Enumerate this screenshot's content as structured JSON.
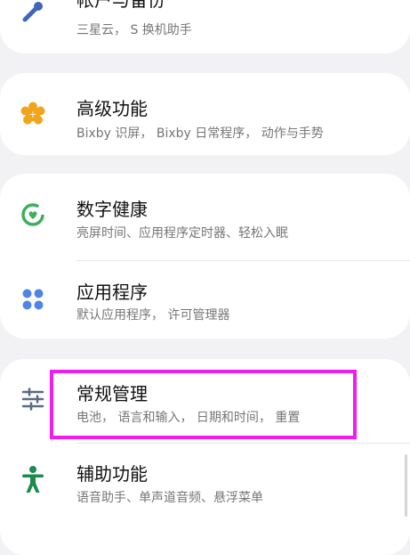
{
  "items": [
    {
      "title": "帐户与备份",
      "subtitle": "三星云， S 换机助手",
      "icon": "account-sync-icon",
      "color": "#3f67b8"
    },
    {
      "title": "高级功能",
      "subtitle": "Bixby 识屏， Bixby 日常程序， 动作与手势",
      "icon": "advanced-features-gear-icon",
      "color": "#f2a41c"
    },
    {
      "title": "数字健康",
      "subtitle": "亮屏时间、应用程序定时器、轻松入眠",
      "icon": "digital-wellbeing-icon",
      "color": "#3fae5f"
    },
    {
      "title": "应用程序",
      "subtitle": "默认应用程序， 许可管理器",
      "icon": "apps-grid-icon",
      "color": "#4f86e6"
    },
    {
      "title": "常规管理",
      "subtitle": "电池， 语言和输入， 日期和时间， 重置",
      "icon": "sliders-icon",
      "color": "#5a6b85"
    },
    {
      "title": "辅助功能",
      "subtitle": "语音助手、单声道音频、悬浮菜单",
      "icon": "accessibility-person-icon",
      "color": "#1f8a4d"
    }
  ],
  "highlight_color": "#f21bf2"
}
